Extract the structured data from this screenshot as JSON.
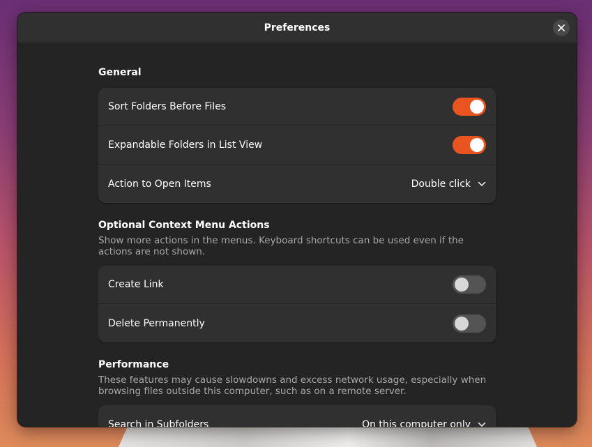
{
  "window": {
    "title": "Preferences",
    "close_icon": "close-icon"
  },
  "general": {
    "title": "General",
    "sort_folders": {
      "label": "Sort Folders Before Files",
      "enabled": true
    },
    "expandable_folders": {
      "label": "Expandable Folders in List View",
      "enabled": true
    },
    "action_open": {
      "label": "Action to Open Items",
      "value": "Double click"
    }
  },
  "context_menu": {
    "title": "Optional Context Menu Actions",
    "description": "Show more actions in the menus. Keyboard shortcuts can be used even if the actions are not shown.",
    "create_link": {
      "label": "Create Link",
      "enabled": false
    },
    "delete_permanently": {
      "label": "Delete Permanently",
      "enabled": false
    }
  },
  "performance": {
    "title": "Performance",
    "description": "These features may cause slowdowns and excess network usage, especially when browsing files outside this computer, such as on a remote server.",
    "search_subfolders": {
      "label": "Search in Subfolders",
      "value": "On this computer only"
    }
  },
  "colors": {
    "accent": "#e95420",
    "window_bg": "#242424",
    "card_bg": "#303030"
  }
}
